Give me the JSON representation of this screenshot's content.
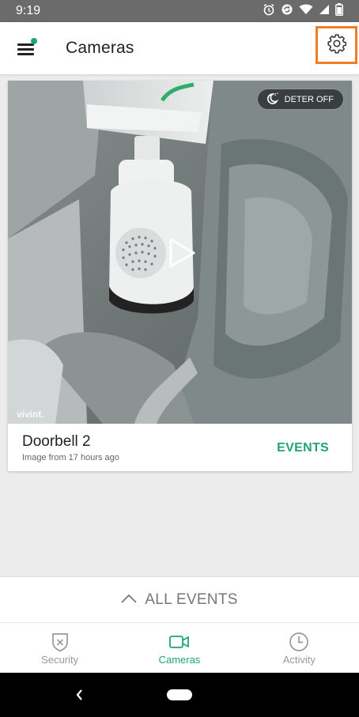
{
  "status_bar": {
    "time": "9:19",
    "icons": [
      "alarm-icon",
      "sync-icon",
      "wifi-icon",
      "signal-icon",
      "battery-icon"
    ]
  },
  "app_bar": {
    "title": "Cameras",
    "menu_icon": "hamburger-icon",
    "notification_dot_color": "#1fa37a",
    "settings_icon": "gear-icon",
    "settings_highlight_color": "#f47c20"
  },
  "camera_card": {
    "name": "Doorbell 2",
    "subtitle": "Image from 17 hours ago",
    "deter_label": "DETER OFF",
    "events_label": "EVENTS",
    "watermark": "vivint."
  },
  "all_events": {
    "label": "ALL EVENTS"
  },
  "bottom_nav": {
    "items": [
      {
        "label": "Security",
        "icon": "shield-icon"
      },
      {
        "label": "Cameras",
        "icon": "video-camera-icon",
        "active": true
      },
      {
        "label": "Activity",
        "icon": "clock-icon"
      }
    ]
  },
  "colors": {
    "accent": "#1fa37a",
    "status_bar": "#6b6b6b"
  }
}
